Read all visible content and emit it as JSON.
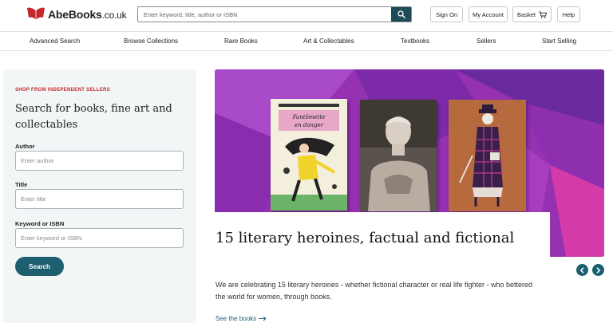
{
  "header": {
    "logo_name": "AbeBooks",
    "logo_tld": ".co.uk",
    "search_placeholder": "Enter keyword, title, author or ISBN",
    "sign_on": "Sign On",
    "my_account": "My Account",
    "basket": "Basket",
    "help": "Help"
  },
  "nav": {
    "items": [
      "Advanced Search",
      "Browse Collections",
      "Rare Books",
      "Art & Collectables",
      "Textbooks",
      "Sellers",
      "Start Selling"
    ]
  },
  "search_panel": {
    "eyebrow": "SHOP FROM INDEPENDENT SELLERS",
    "heading": "Search for books, fine art and collectables",
    "author_label": "Author",
    "author_placeholder": "Enter author",
    "title_label": "Title",
    "title_placeholder": "Enter title",
    "keyword_label": "Keyword or ISBN",
    "keyword_placeholder": "Enter keyword or ISBN",
    "search_button": "Search"
  },
  "hero": {
    "book1_title": "Fantômette en danger",
    "title": "15 literary heroines, factual and fictional",
    "description": "We are celebrating 15 literary heroines - whether fictional character or real life fighter - who bettered the world for women, through books.",
    "link": "See the books"
  },
  "colors": {
    "brand_red": "#c4282a",
    "accent_teal": "#1d5f6e",
    "hero_purple": "#9a34b4"
  },
  "icons": {
    "logo": "book-logo-icon",
    "search": "search-icon",
    "basket": "cart-icon",
    "link_arrow": "arrow-right-icon",
    "prev": "chevron-left-icon",
    "next": "chevron-right-icon"
  }
}
